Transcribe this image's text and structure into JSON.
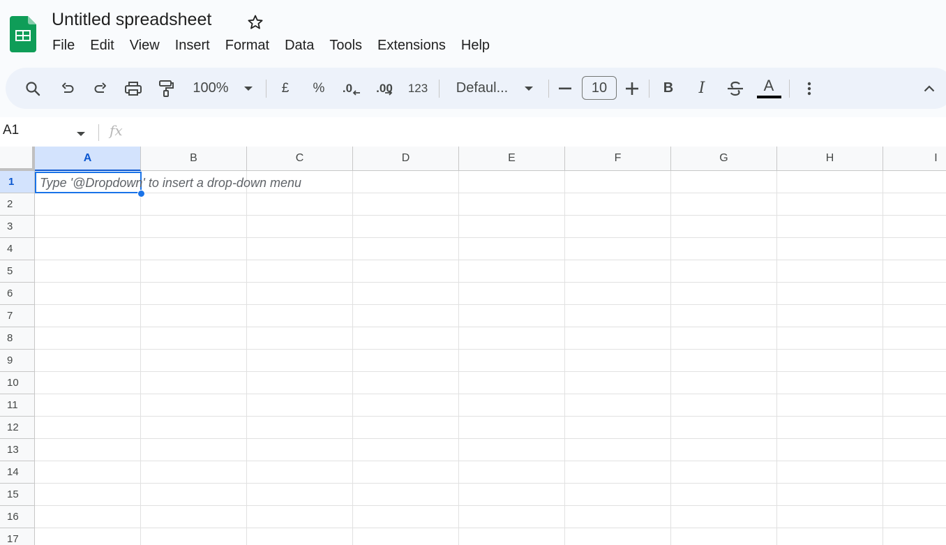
{
  "app": {
    "doc_title": "Untitled spreadsheet",
    "menu": [
      "File",
      "Edit",
      "View",
      "Insert",
      "Format",
      "Data",
      "Tools",
      "Extensions",
      "Help"
    ]
  },
  "toolbar": {
    "zoom": "100%",
    "currency": "£",
    "percent": "%",
    "decrease_decimal": ".0",
    "increase_decimal": ".00",
    "number_format": "123",
    "font_family": "Defaul...",
    "font_size": "10",
    "font_decrease": "–",
    "font_increase": "+",
    "bold": "B",
    "italic": "I",
    "text_color_label": "A",
    "text_color": "#000000",
    "accent": "#0b57d0"
  },
  "formula_bar": {
    "name_box": "A1",
    "fx_label": "fx",
    "value": ""
  },
  "sheet": {
    "columns": [
      "A",
      "B",
      "C",
      "D",
      "E",
      "F",
      "G",
      "H",
      "I"
    ],
    "rows": [
      "1",
      "2",
      "3",
      "4",
      "5",
      "6",
      "7",
      "8",
      "9",
      "10",
      "11",
      "12",
      "13",
      "14",
      "15",
      "16",
      "17"
    ],
    "selected_cell": "A1",
    "active_cell_hint": "Type '@Dropdown' to insert a drop-down menu"
  }
}
